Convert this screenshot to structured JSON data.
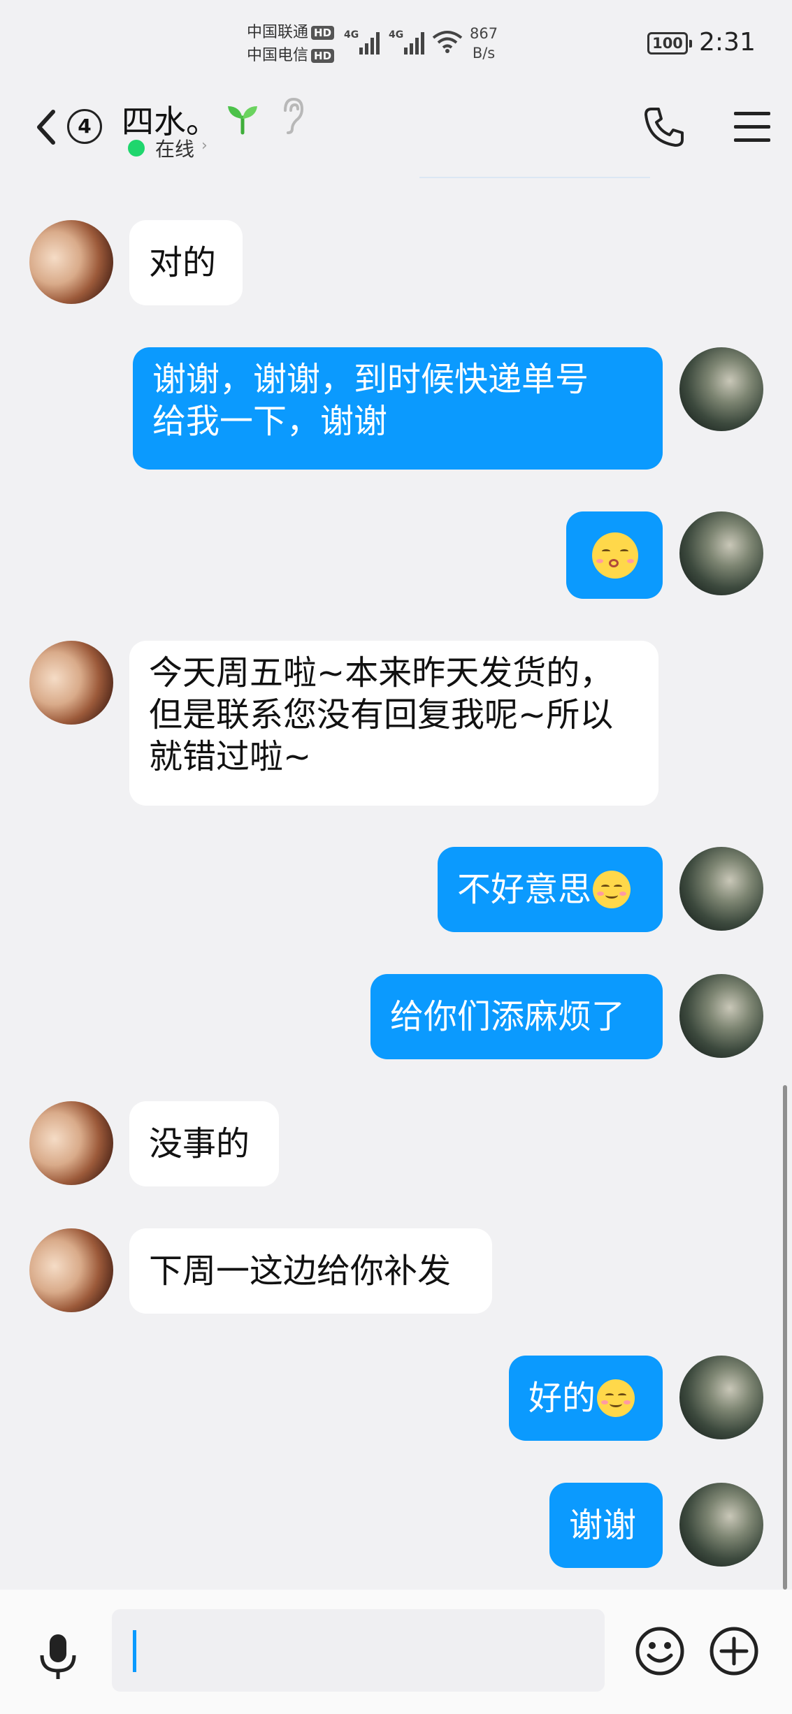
{
  "status_bar": {
    "carrier1": "中国联通",
    "carrier2": "中国电信",
    "hd_label": "HD",
    "net_tag": "4G",
    "net_speed_value": "867",
    "net_speed_unit": "B/s",
    "battery": "100",
    "time": "2:31"
  },
  "header": {
    "unread_count": "4",
    "contact_name": "四水。",
    "online_status": "在线",
    "status_chevron": "›"
  },
  "messages": [
    {
      "side": "in",
      "text": "对的"
    },
    {
      "side": "out",
      "lines": [
        "谢谢，谢谢，到时候快递单号",
        "给我一下，谢谢"
      ]
    },
    {
      "side": "out",
      "emoji": "kissing-face-emoji"
    },
    {
      "side": "in",
      "lines": [
        "今天周五啦~本来昨天发货的，",
        "但是联系您没有回复我呢~所以",
        "就错过啦~"
      ]
    },
    {
      "side": "out",
      "text": "不好意思",
      "emoji": "blush-smile-emoji"
    },
    {
      "side": "out",
      "text": "给你们添麻烦了"
    },
    {
      "side": "in",
      "text": "没事的"
    },
    {
      "side": "in",
      "text": "下周一这边给你补发"
    },
    {
      "side": "out",
      "text": "好的",
      "emoji": "blush-smile-emoji"
    },
    {
      "side": "out",
      "text": "谢谢"
    }
  ],
  "colors": {
    "outgoing_bubble": "#0b9afe",
    "incoming_bubble": "#ffffff",
    "background": "#f1f1f3",
    "online_dot": "#1fd66d"
  },
  "icons": {
    "back": "back-chevron-icon",
    "sprout": "sprout-icon",
    "ear": "ear-icon",
    "phone": "phone-icon",
    "menu": "hamburger-menu-icon",
    "mic": "microphone-icon",
    "emoji": "emoji-smile-icon",
    "plus": "plus-circle-icon"
  }
}
